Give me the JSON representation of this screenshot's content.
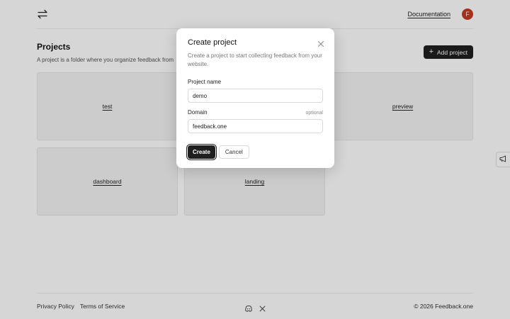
{
  "header": {
    "logo_icon": "swap-arrows-icon",
    "documentation_label": "Documentation",
    "avatar_initial": "F",
    "avatar_color": "#c63a22"
  },
  "page": {
    "title": "Projects",
    "subtitle": "A project is a folder where you organize feedback from",
    "add_button_label": "Add project"
  },
  "projects": [
    {
      "name": "test"
    },
    {
      "name": "preview"
    },
    {
      "name": "dashboard"
    },
    {
      "name": "landing"
    }
  ],
  "footer": {
    "privacy_label": "Privacy Policy",
    "terms_label": "Terms of Service",
    "icons": [
      "discord-icon",
      "x-icon"
    ],
    "copyright": "© 2026 Feedback.one"
  },
  "side_widget": {
    "icon": "megaphone-icon"
  },
  "modal": {
    "title": "Create project",
    "description": "Create a project to start collecting feedback from your website.",
    "project_name_label": "Project name",
    "project_name_value": "demo",
    "domain_label": "Domain",
    "domain_optional": "optional",
    "domain_value": "feedback.one",
    "create_label": "Create",
    "cancel_label": "Cancel"
  },
  "colors": {
    "primary_button": "#1f1f1f",
    "overlay": "rgba(0,0,0,0.16)"
  }
}
